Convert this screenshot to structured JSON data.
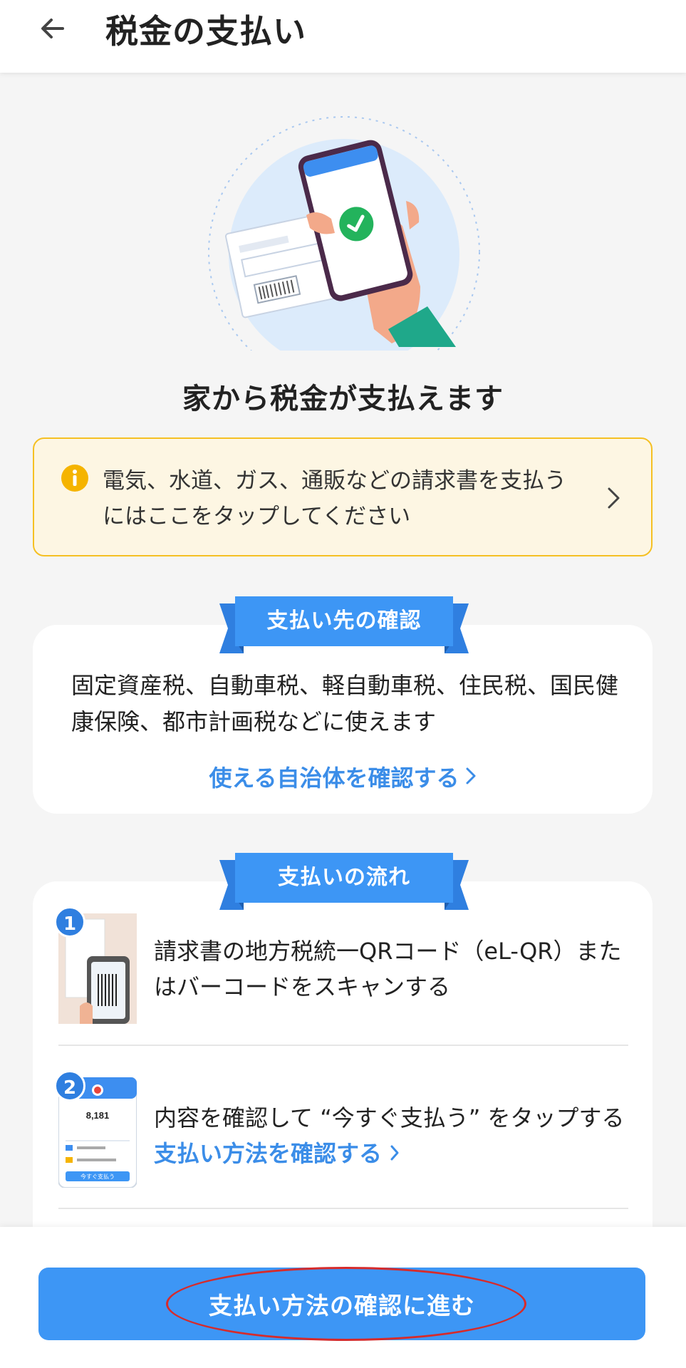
{
  "header": {
    "title": "税金の支払い"
  },
  "hero": {
    "headline": "家から税金が支払えます"
  },
  "notice": {
    "text": "電気、水道、ガス、通販などの請求書を支払うにはここをタップしてください"
  },
  "destination": {
    "ribbon": "支払い先の確認",
    "text": "固定資産税、自動車税、軽自動車税、住民税、国民健康保険、都市計画税などに使えます",
    "link": "使える自治体を確認する"
  },
  "flow": {
    "ribbon": "支払いの流れ",
    "steps": [
      {
        "number": "1",
        "text": "請求書の地方税統一QRコード（eL-QR）またはバーコードをスキャンする"
      },
      {
        "number": "2",
        "text": "内容を確認して “今すぐ支払う” をタップする",
        "link": "支払い方法を確認する",
        "thumb_amount": "8,181",
        "thumb_button": "今すぐ支払う"
      }
    ]
  },
  "cta": {
    "label": "支払い方法の確認に進む"
  },
  "colors": {
    "accent": "#3d96f5",
    "link": "#3b8de8",
    "notice_bg": "#fdf6e3",
    "notice_border": "#f5c023",
    "annotation": "#d62b2b"
  }
}
